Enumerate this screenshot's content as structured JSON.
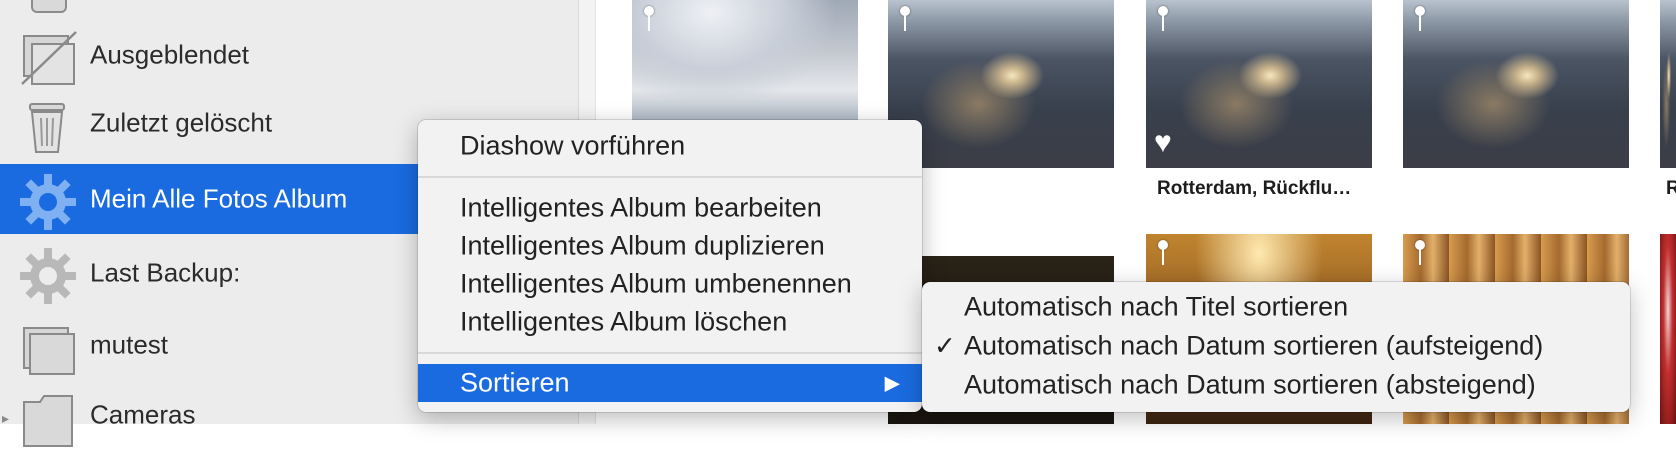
{
  "sidebar": {
    "items": [
      {
        "label": "Ausgeblendet",
        "icon": "hidden-album-icon"
      },
      {
        "label": "Zuletzt gelöscht",
        "icon": "trash-icon"
      },
      {
        "label": "Mein Alle Fotos Album",
        "icon": "gear-icon",
        "selected": true
      },
      {
        "label": "Last Backup:",
        "icon": "gear-icon"
      },
      {
        "label": "mutest",
        "icon": "album-icon"
      },
      {
        "label": "Cameras",
        "icon": "folder-icon"
      }
    ]
  },
  "grid": {
    "captions": [
      "Rotterdam, Rückflu…",
      "R"
    ]
  },
  "context_menu": {
    "items": [
      "Diashow vorführen",
      "Intelligentes Album bearbeiten",
      "Intelligentes Album duplizieren",
      "Intelligentes Album umbenennen",
      "Intelligentes Album löschen",
      "Sortieren"
    ],
    "submenu_arrow": "▶"
  },
  "submenu": {
    "items": [
      "Automatisch nach Titel sortieren",
      "Automatisch nach Datum sortieren (aufsteigend)",
      "Automatisch nach Datum sortieren (absteigend)"
    ],
    "checkmark": "✓",
    "checked_index": 1
  },
  "colors": {
    "accent": "#1a6be0",
    "sidebar_bg": "#ececec",
    "menu_bg": "#f2f2f2"
  }
}
